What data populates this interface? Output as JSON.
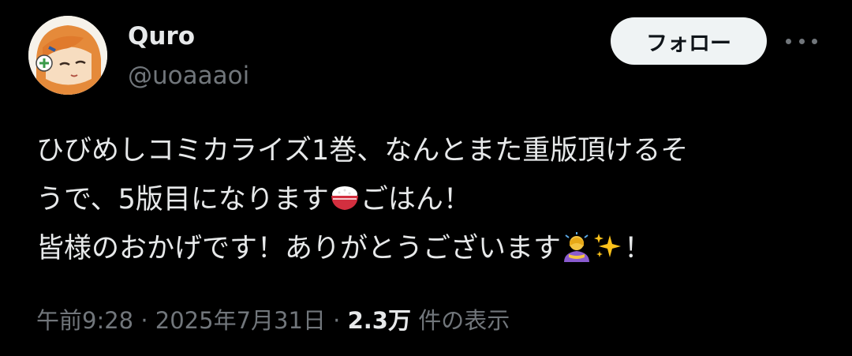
{
  "user": {
    "display_name": "Quro",
    "handle": "@uoaaaoi"
  },
  "actions": {
    "follow_label": "フォロー",
    "more_icon": "more-horizontal-icon"
  },
  "tweet": {
    "line1": "ひびめしコミカライズ1巻、なんとまた重版頂けるそ",
    "line2_a": "うで、5版目になります",
    "line2_b": "ごはん！",
    "line3_a": "皆様のおかげです！ありがとうございます",
    "line3_b": "！",
    "emojis": [
      "rice-bowl-icon",
      "person-bowing-icon",
      "sparkles-icon"
    ]
  },
  "meta": {
    "time": "午前9:28",
    "separator": "·",
    "date": "2025年7月31日",
    "views_count": "2.3万",
    "views_label": "件の表示"
  },
  "colors": {
    "background": "#000000",
    "text": "#e7e9ea",
    "secondary": "#71767b",
    "button_bg": "#eff3f4"
  }
}
